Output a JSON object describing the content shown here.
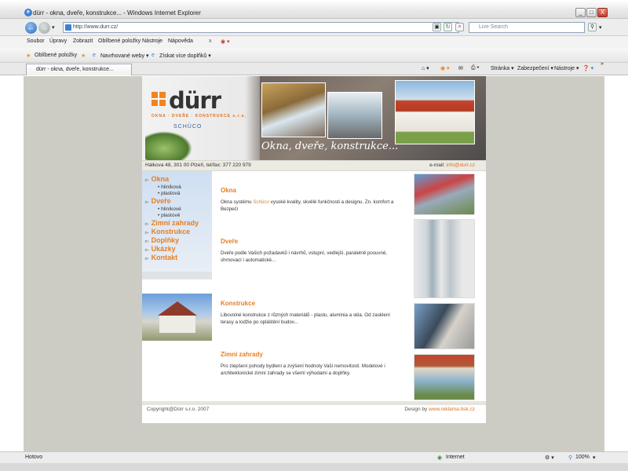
{
  "window": {
    "title": "dürr - okna, dveře, konstrukce... - Windows Internet Explorer",
    "controls": [
      "_",
      "□",
      "X"
    ]
  },
  "address": {
    "url": "http://www.durr.cz/",
    "search_placeholder": "Live Search"
  },
  "menu": {
    "items": [
      "Soubor",
      "Úpravy",
      "Zobrazit",
      "Oblíbené položky",
      "Nástroje",
      "Nápověda"
    ]
  },
  "favorites_bar": {
    "favorites_label": "Oblíbené položky",
    "suggested_sites": "Navrhované weby ▾",
    "get_addons": "Získat více doplňků ▾"
  },
  "tab": {
    "label": "dürr - okna, dveře, konstrukce...",
    "commands": [
      "Stránka ▾",
      "Zabezpečení ▾",
      "Nástroje ▾"
    ]
  },
  "status": {
    "left": "Hotovo",
    "zone": "Internet",
    "zoom": "100%"
  },
  "site": {
    "logo": {
      "name": "dürr",
      "tagline": "OKNA · DVEŘE · KONSTRUKCE s.r.o.",
      "brand": "SCHÜCO"
    },
    "banner_caption": "Okna, dveře, konstrukce...",
    "contact": {
      "address": "Hálkova 48, 301 00 Plzeň, tel/fax: 377 220 979",
      "email_label": "e-mail:",
      "email": "info@durr.cz"
    },
    "nav": [
      {
        "label": "Okna",
        "subs": [
          "hliníková",
          "plastová"
        ]
      },
      {
        "label": "Dveře",
        "subs": [
          "hliníkové",
          "plastové"
        ]
      },
      {
        "label": "Zimní zahrady",
        "subs": []
      },
      {
        "label": "Konstrukce",
        "subs": []
      },
      {
        "label": "Doplňky",
        "subs": []
      },
      {
        "label": "Ukázky",
        "subs": []
      },
      {
        "label": "Kontakt",
        "subs": []
      }
    ],
    "sections": [
      {
        "title": "Okna",
        "text_before": "Okna systému ",
        "highlight": "Schüco",
        "text_after": " vysoké kvality, skvělé funkčnosti a designu. Zn. komfort a Bezpečí"
      },
      {
        "title": "Dveře",
        "text": "Dveře podle Vašich požadavků i návrhů, vstupní, vedlejší, paralelně posuvné, shrnovací i automatické..."
      },
      {
        "title": "Konstrukce",
        "text": "Libovolné konstrukce z různých materiálů - plastu, aluminia a skla. Od zasklení terasy a lodžie po opláštění budov..."
      },
      {
        "title": "Zimní zahrady",
        "text": "Pro zlepšení pohody bydlení a zvýšení hodnoty Vaší nemovitosti. Modelové i architektonické zimní zahrady se všemi výhodami a doplňky."
      }
    ],
    "footer": {
      "copyright": "Copyright@Dürr s.r.o. 2007",
      "design_label": "Design by",
      "design_link": "www.reklama-tisk.cz"
    }
  }
}
